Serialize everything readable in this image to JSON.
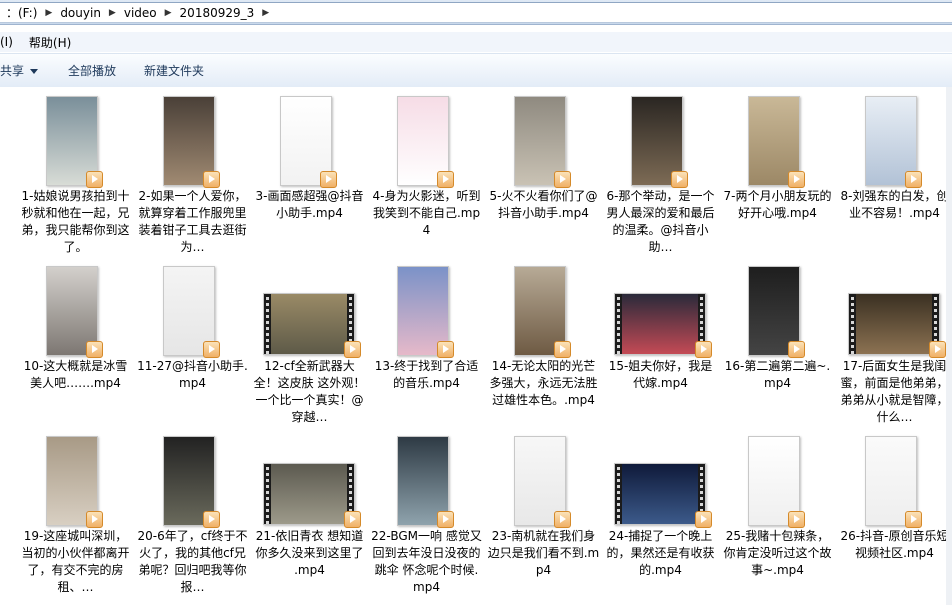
{
  "address": {
    "crumbs": [
      "：(F:)",
      "douyin",
      "video",
      "20180929_3"
    ]
  },
  "menu": [
    "(I)",
    "帮助(H)"
  ],
  "toolbar": {
    "share": "共享",
    "play_all": "全部播放",
    "new_folder": "新建文件夹"
  },
  "files": [
    {
      "name": "1-姑娘说男孩拍到十秒就和他在一起，兄弟，我只能帮你到这了。",
      "orient": "portrait",
      "c1": "#7a8f9a",
      "c2": "#d8dcd6"
    },
    {
      "name": "2-如果一个人爱你，就算穿着工作服兜里装着钳子工具去逛街为…",
      "orient": "portrait",
      "c1": "#4a4038",
      "c2": "#a08a72"
    },
    {
      "name": "3-画面感超强@抖音小助手.mp4",
      "orient": "portrait",
      "c1": "#ffffff",
      "c2": "#f2f2f2"
    },
    {
      "name": "4-身为火影迷，听到我笑到不能自己.mp4",
      "orient": "portrait",
      "c1": "#f6dce6",
      "c2": "#ffffff"
    },
    {
      "name": "5-火不火看你们了@抖音小助手.mp4",
      "orient": "portrait",
      "c1": "#8f8a80",
      "c2": "#c9c2b4"
    },
    {
      "name": "6-那个举动，是一个男人最深的爱和最后的温柔。@抖音小助…",
      "orient": "portrait",
      "c1": "#2a2622",
      "c2": "#7d6b55"
    },
    {
      "name": "7-两个月小朋友玩的好开心哦.mp4",
      "orient": "portrait",
      "c1": "#c9b897",
      "c2": "#9c8866"
    },
    {
      "name": "8-刘强东的白发，创业不容易！.mp4",
      "orient": "portrait",
      "c1": "#e8eef5",
      "c2": "#b2c2d6"
    },
    {
      "name": "10-这大概就是冰雪美人吧…….mp4",
      "orient": "portrait",
      "c1": "#d3d0cc",
      "c2": "#7d7772"
    },
    {
      "name": "11-27@抖音小助手.mp4",
      "orient": "portrait",
      "c1": "#f4f4f4",
      "c2": "#e6e6e6"
    },
    {
      "name": "12-cf全新武器大全！这皮肤 这外观！一个比一个真实！@穿越…",
      "orient": "landscape",
      "c1": "#9a8a66",
      "c2": "#5e5a48"
    },
    {
      "name": "13-终于找到了合适的音乐.mp4",
      "orient": "portrait",
      "c1": "#7b92c8",
      "c2": "#e6b9c9"
    },
    {
      "name": "14-无论太阳的光芒多强大，永远无法胜过雄性本色。.mp4",
      "orient": "portrait",
      "c1": "#b7aa96",
      "c2": "#6e5a43"
    },
    {
      "name": "15-姐夫你好，我是代嫁.mp4",
      "orient": "landscape",
      "c1": "#2a2a3a",
      "c2": "#c44a55"
    },
    {
      "name": "16-第二遍第二遍~.mp4",
      "orient": "portrait",
      "c1": "#1e1e1e",
      "c2": "#444444"
    },
    {
      "name": "17-后面女生是我闺蜜，前面是他弟弟，弟弟从小就是智障，什么…",
      "orient": "landscape",
      "c1": "#3a3022",
      "c2": "#8c7252"
    },
    {
      "name": "19-这座城叫深圳，当初的小伙伴都离开了，有交不完的房租、…",
      "orient": "portrait",
      "c1": "#a89a86",
      "c2": "#d8cfc2"
    },
    {
      "name": "20-6年了，cf终于不火了，我的其他cf兄弟呢？回归吧我等你报…",
      "orient": "portrait",
      "c1": "#222222",
      "c2": "#6a6a5c"
    },
    {
      "name": "21-依旧青衣 想知道你多久没来到这里了 .mp4",
      "orient": "landscape",
      "c1": "#5c5a50",
      "c2": "#9d9a8a"
    },
    {
      "name": "22-BGM一响 感觉又回到去年没日没夜的跳伞 怀念呢个时候.mp4",
      "orient": "portrait",
      "c1": "#2e3a44",
      "c2": "#8fa3ad"
    },
    {
      "name": "23-南机就在我们身边只是我们看不到.mp4",
      "orient": "portrait",
      "c1": "#f7f7f7",
      "c2": "#e8e8e8"
    },
    {
      "name": "24-捕捉了一个晚上的，果然还是有收获的.mp4",
      "orient": "landscape",
      "c1": "#0f1a3a",
      "c2": "#3c5a8a"
    },
    {
      "name": "25-我赌十包辣条，你肯定没听过这个故事~.mp4",
      "orient": "portrait",
      "c1": "#ffffff",
      "c2": "#efefef"
    },
    {
      "name": "26-抖音-原创音乐短视频社区.mp4",
      "orient": "portrait",
      "c1": "#fafafa",
      "c2": "#eeeeee"
    }
  ]
}
